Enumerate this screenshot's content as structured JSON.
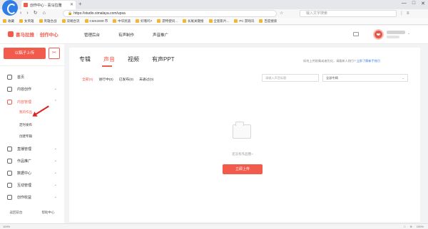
{
  "browser": {
    "tab_title": "创作中心 - 喜马拉雅",
    "tab_close": "✕",
    "new_tab": "+",
    "window_controls": [
      "—",
      "□",
      "✕"
    ],
    "url": "https://studio.ximalaya.com/upsa",
    "search_placeholder": "输入文字搜索",
    "nav_icons": [
      "back-icon",
      "forward-icon",
      "reload-icon",
      "home-icon"
    ],
    "bookmarks": [
      "收藏",
      "女英雄",
      "英雄合战",
      "双端合流",
      "CMS2009 市",
      "中华民族",
      "好看吗?",
      "游特使问...",
      "长尾关键搜",
      "全套影片...",
      "PC 游戏讯",
      "百度搜索"
    ]
  },
  "header": {
    "logo_brand": "喜马拉雅",
    "logo_sub": "创作中心",
    "nav": [
      "管理后台",
      "有声制作",
      "声音推广"
    ]
  },
  "sidebar": {
    "upload_label": "以稿子上传",
    "scissors_icon": "✂",
    "items": [
      {
        "label": "首页",
        "icon": "home-icon"
      },
      {
        "label": "内容创作",
        "icon": "edit-icon",
        "arrow": "⌄"
      },
      {
        "label": "内容管理",
        "icon": "folder-icon",
        "arrow": "⌃",
        "active": true
      }
    ],
    "subitems": [
      "我的作品",
      "定时发布",
      "创建专辑"
    ],
    "items2": [
      {
        "label": "直播管理",
        "icon": "live-icon",
        "arrow": "⌄"
      },
      {
        "label": "作品推广",
        "icon": "promote-icon",
        "arrow": "⌄"
      },
      {
        "label": "数据中心",
        "icon": "data-icon",
        "arrow": "⌄"
      },
      {
        "label": "互动管理",
        "icon": "chat-icon",
        "arrow": "⌄"
      },
      {
        "label": "创作收益",
        "icon": "coin-icon",
        "arrow": "⌄"
      }
    ],
    "bottom": [
      "返回前台",
      "帮助中心"
    ]
  },
  "main": {
    "tabs": [
      "专辑",
      "声音",
      "视频",
      "有声PPT"
    ],
    "help_prefix": "如何上传剧集或者优化，请看新人指引?",
    "help_link": "立即了解新手指引",
    "subtabs": [
      "全部(0)",
      "进行中(0)",
      "已发布(0)",
      "未通过(0)"
    ],
    "search_placeholder": "请输入声音标题",
    "album_select": "全部专辑",
    "empty_text": "还没有作品哦~",
    "upload_cta": "立即上传"
  },
  "statusbar": {
    "left": "100%",
    "right": [
      "□",
      "⊕",
      "100%"
    ]
  },
  "colors": {
    "accent": "#f25a4b",
    "link": "#3b7ddd"
  }
}
